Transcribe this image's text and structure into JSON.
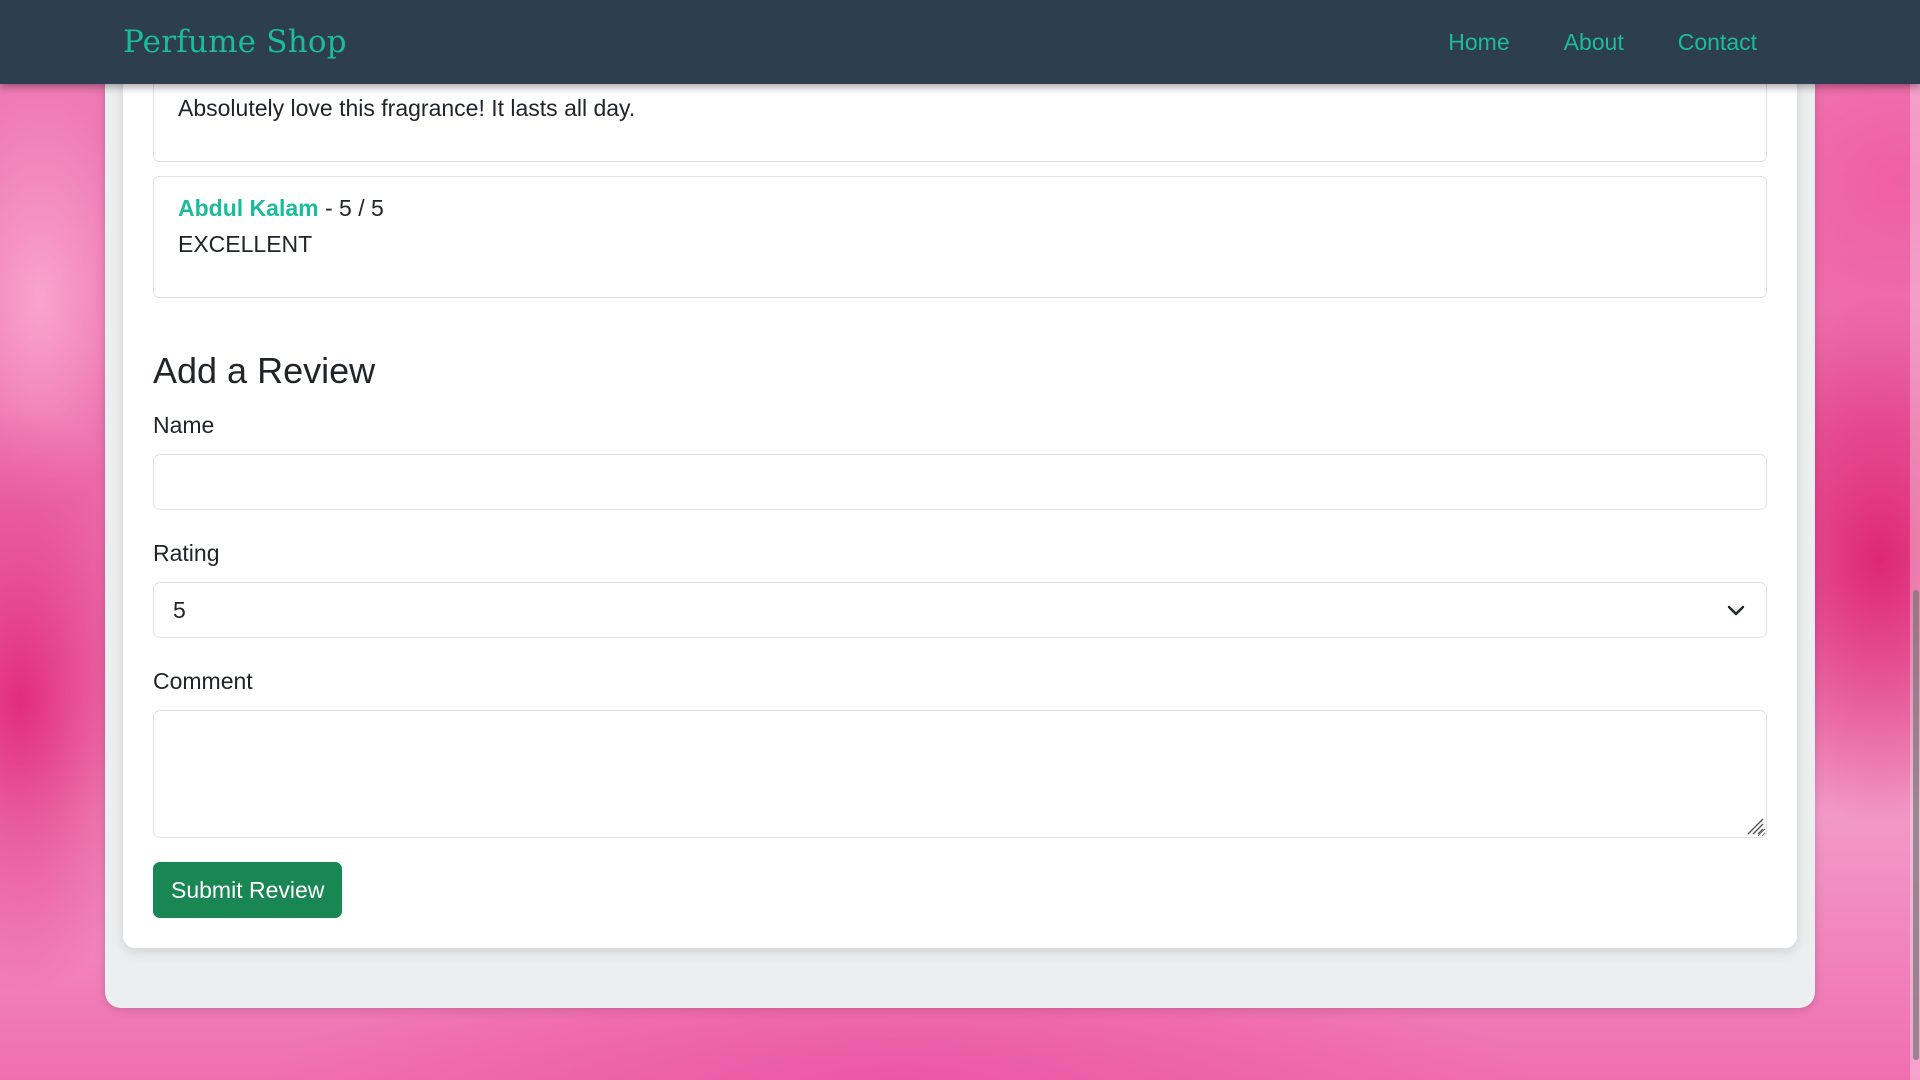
{
  "navbar": {
    "brand": "Perfume Shop",
    "links": [
      {
        "label": "Home"
      },
      {
        "label": "About"
      },
      {
        "label": "Contact"
      }
    ]
  },
  "reviews": [
    {
      "comment": "Absolutely love this fragrance! It lasts all day."
    },
    {
      "author": "Abdul Kalam",
      "rating_text": " - 5 / 5",
      "comment": "EXCELLENT"
    }
  ],
  "review_form": {
    "title": "Add a Review",
    "name_label": "Name",
    "name_value": "",
    "rating_label": "Rating",
    "rating_value": "5",
    "comment_label": "Comment",
    "comment_value": "",
    "submit_label": "Submit Review"
  },
  "colors": {
    "navbar_bg": "#2c3e50",
    "accent": "#1abc9c",
    "submit_bg": "#198754"
  },
  "icons": {
    "select_arrow": "chevron-down-icon",
    "textarea_resize": "resize-grip-icon"
  }
}
